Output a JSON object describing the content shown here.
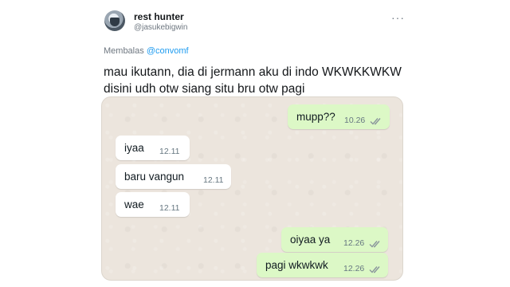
{
  "tweet": {
    "display_name": "rest hunter",
    "handle": "@jasukebigwin",
    "more_icon": "ellipsis-icon",
    "reply_prefix": "Membalas",
    "reply_mention": "@convomf",
    "text_line1": "mau ikutann, dia di jermann aku di indo WKWKKWKW",
    "text_line2": "disini udh otw siang situ bru otw pagi"
  },
  "chat": {
    "messages": [
      {
        "direction": "out",
        "text": "mupp??",
        "time": "10.26",
        "status_icon": "double-check-icon"
      },
      {
        "direction": "in",
        "text": "iyaa",
        "time": "12.11"
      },
      {
        "direction": "in",
        "text": "baru vangun",
        "time": "12.11"
      },
      {
        "direction": "in",
        "text": "wae",
        "time": "12.11"
      },
      {
        "direction": "out",
        "text": "oiyaa ya",
        "time": "12.26",
        "status_icon": "double-check-icon"
      },
      {
        "direction": "out",
        "text": "pagi wkwkwk",
        "time": "12.26",
        "status_icon": "double-check-icon"
      }
    ]
  },
  "colors": {
    "chat_background": "#ece5dd",
    "incoming_bubble": "#ffffff",
    "outgoing_bubble": "#dcf8c6",
    "mention": "#1d9bf0",
    "read_ticks": "#8a959c"
  }
}
